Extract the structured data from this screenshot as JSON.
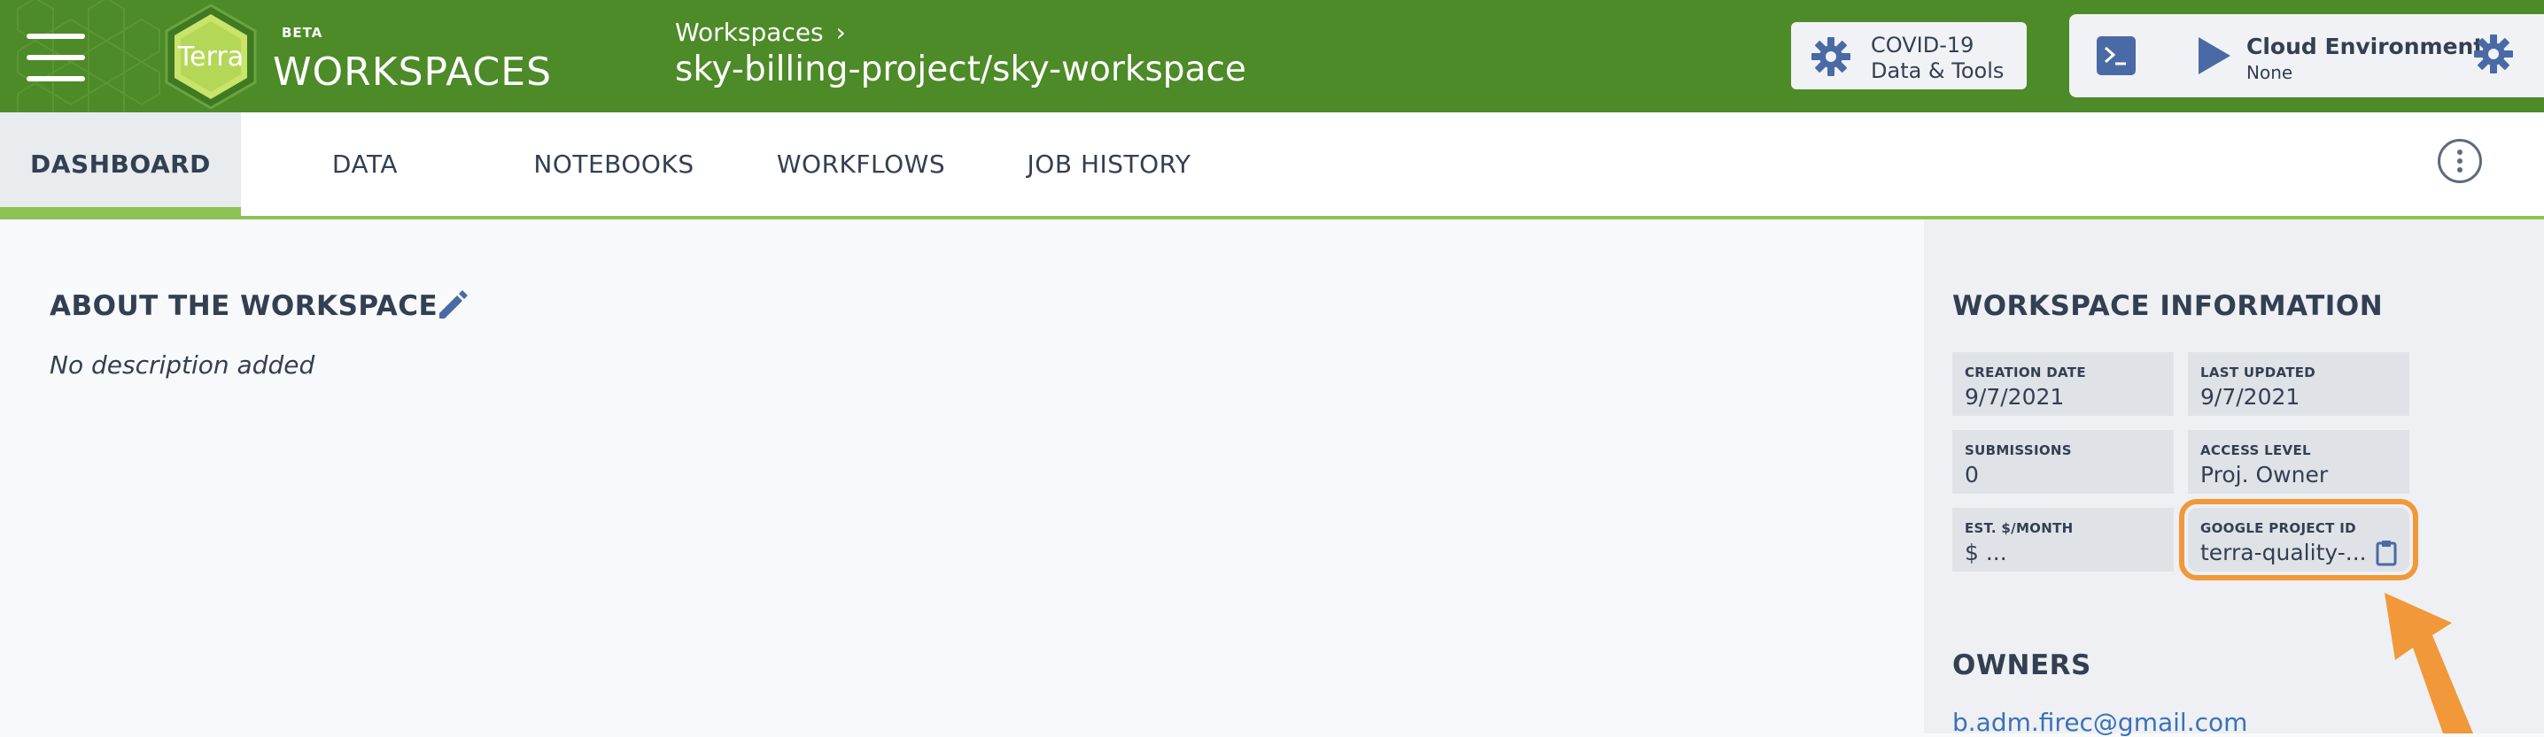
{
  "header": {
    "logo_text": "Terra",
    "beta": "BETA",
    "brand": "WORKSPACES",
    "breadcrumb": "Workspaces",
    "breadcrumb_chevron": "›",
    "workspace_title": "sky-billing-project/sky-workspace",
    "covid_line1": "COVID-19",
    "covid_line2": "Data & Tools",
    "cloud_title": "Cloud Environment",
    "cloud_status": "None",
    "colors": {
      "header_bg": "#4d8a28",
      "accent_green": "#8dc255",
      "logo_yellow": "#c9e36b"
    }
  },
  "tabs": [
    {
      "label": "DASHBOARD",
      "active": true
    },
    {
      "label": "DATA"
    },
    {
      "label": "NOTEBOOKS"
    },
    {
      "label": "WORKFLOWS"
    },
    {
      "label": "JOB HISTORY"
    }
  ],
  "about": {
    "title": "ABOUT THE WORKSPACE",
    "description": "No description added"
  },
  "info": {
    "title": "WORKSPACE INFORMATION",
    "creation_date_label": "CREATION DATE",
    "creation_date": "9/7/2021",
    "last_updated_label": "LAST UPDATED",
    "last_updated": "9/7/2021",
    "submissions_label": "SUBMISSIONS",
    "submissions": "0",
    "access_level_label": "ACCESS LEVEL",
    "access_level": "Proj. Owner",
    "est_month_label": "EST. $/MONTH",
    "est_month": "$ ...",
    "google_project_label": "GOOGLE PROJECT ID",
    "google_project": "terra-quality-...",
    "highlight_color": "#f0983a"
  },
  "owners": {
    "title": "OWNERS",
    "email": "b.adm.firec@gmail.com"
  },
  "icons": [
    "hamburger-icon",
    "terra-logo-icon",
    "gear-icon",
    "terminal-icon",
    "play-icon",
    "kebab-icon",
    "pencil-icon",
    "clipboard-icon",
    "annotation-arrow-icon"
  ]
}
